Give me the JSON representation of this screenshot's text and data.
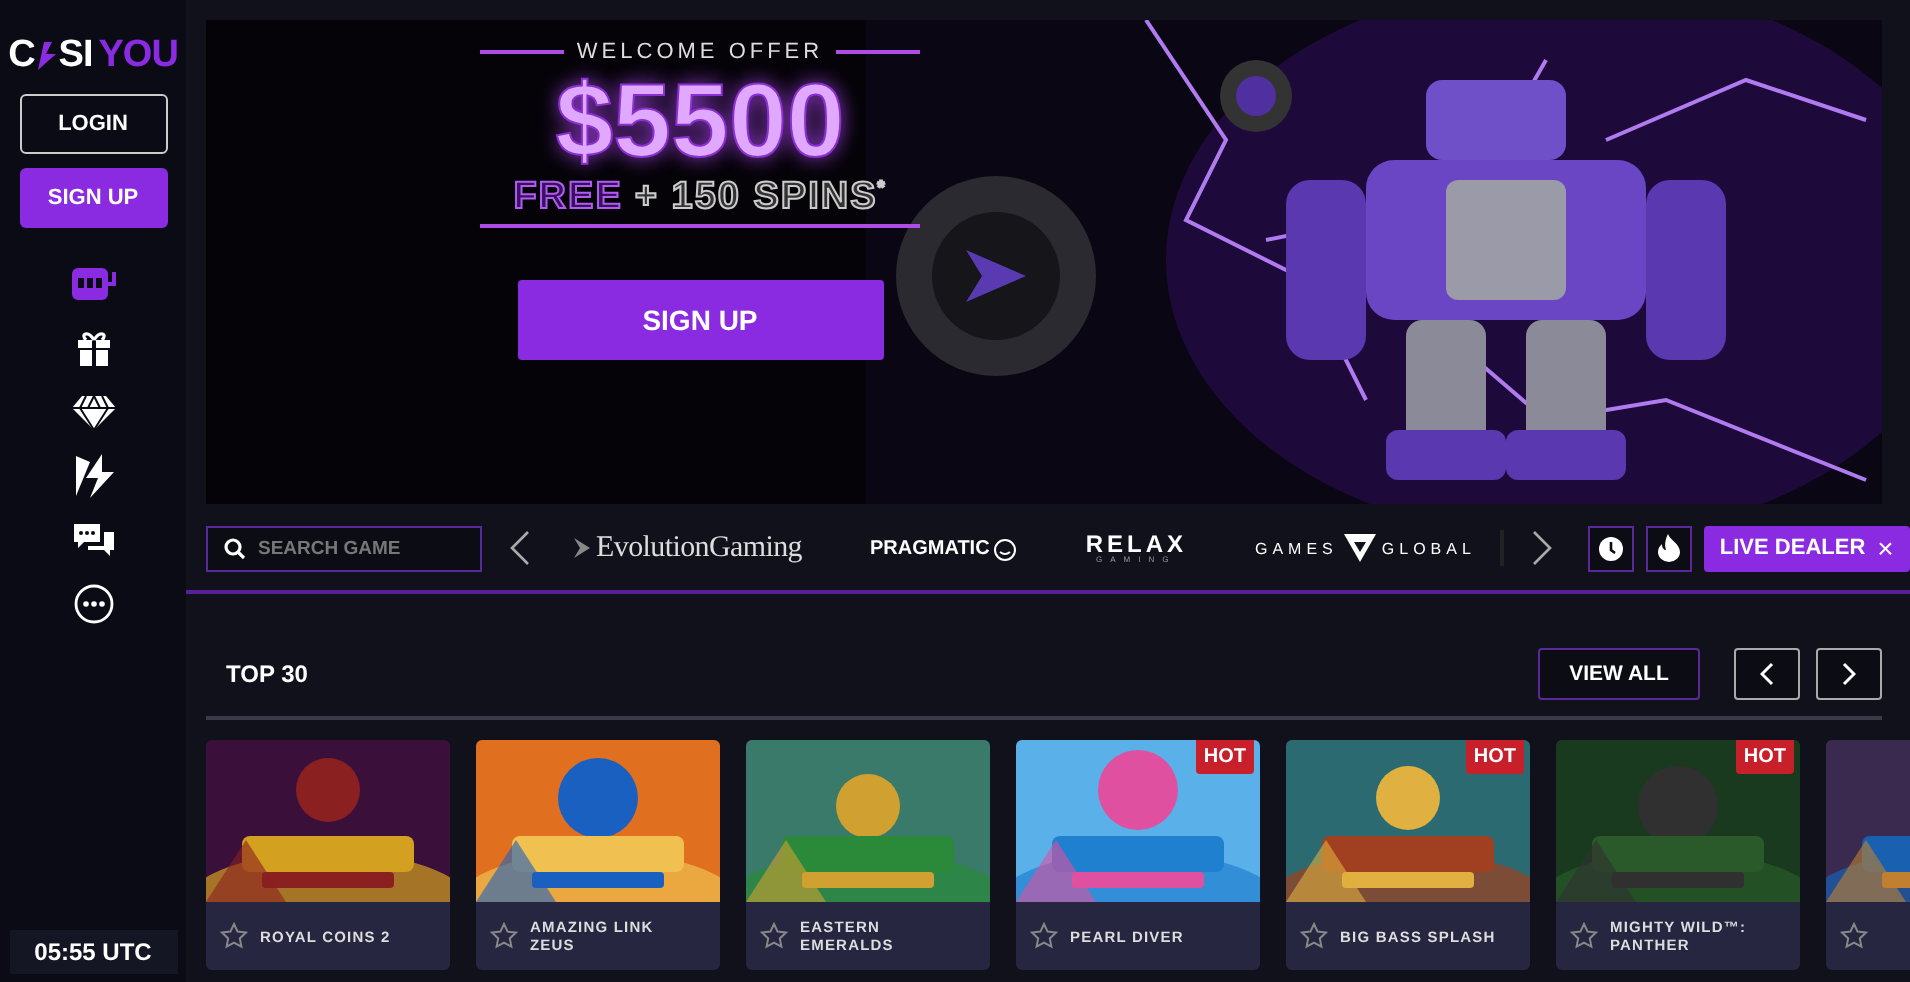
{
  "logo": {
    "first": "C",
    "rest": "SI",
    "accent": "YOU"
  },
  "auth": {
    "login": "LOGIN",
    "signup": "SIGN UP"
  },
  "sidebar": {
    "items": [
      {
        "kind": "slots",
        "selected": true
      },
      {
        "kind": "gift",
        "selected": false
      },
      {
        "kind": "diamond",
        "selected": false
      },
      {
        "kind": "bolt",
        "selected": false
      },
      {
        "kind": "chat",
        "selected": false
      },
      {
        "kind": "more",
        "selected": false
      }
    ]
  },
  "clock": "05:55 UTC",
  "banner": {
    "kicker": "WELCOME OFFER",
    "amount": "$5500",
    "free": "FREE",
    "spins": "+ 150 SPINS$^{*}$",
    "button": "SIGN UP"
  },
  "search": {
    "placeholder": "SEARCH GAME"
  },
  "providers": [
    {
      "kind": "evolution",
      "name": "EvolutionGaming"
    },
    {
      "kind": "pragmatic",
      "name": "PRAGMATIC"
    },
    {
      "kind": "relax",
      "name": "RELAX",
      "sub": "GAMING"
    },
    {
      "kind": "games_global",
      "name": "GAMES",
      "name2": "GLOBAL"
    }
  ],
  "filters": {
    "live_dealer": "LIVE DEALER",
    "close": "×"
  },
  "section": {
    "title": "TOP 30",
    "view_all": "VIEW ALL"
  },
  "games": [
    {
      "title": "ROYAL COINS 2",
      "favorite": false
    },
    {
      "title": "AMAZING LINK ZEUS",
      "favorite": false
    },
    {
      "title": "EASTERN EMERALDS",
      "favorite": false
    },
    {
      "title": "PEARL DIVER",
      "badge": "HOT",
      "favorite": false
    },
    {
      "title": "BIG BASS SPLASH",
      "badge": "HOT",
      "favorite": false
    },
    {
      "title": "MIGHTY WILD™: PANTHER",
      "badge": "HOT",
      "favorite": false
    },
    {
      "favorite": false
    }
  ]
}
